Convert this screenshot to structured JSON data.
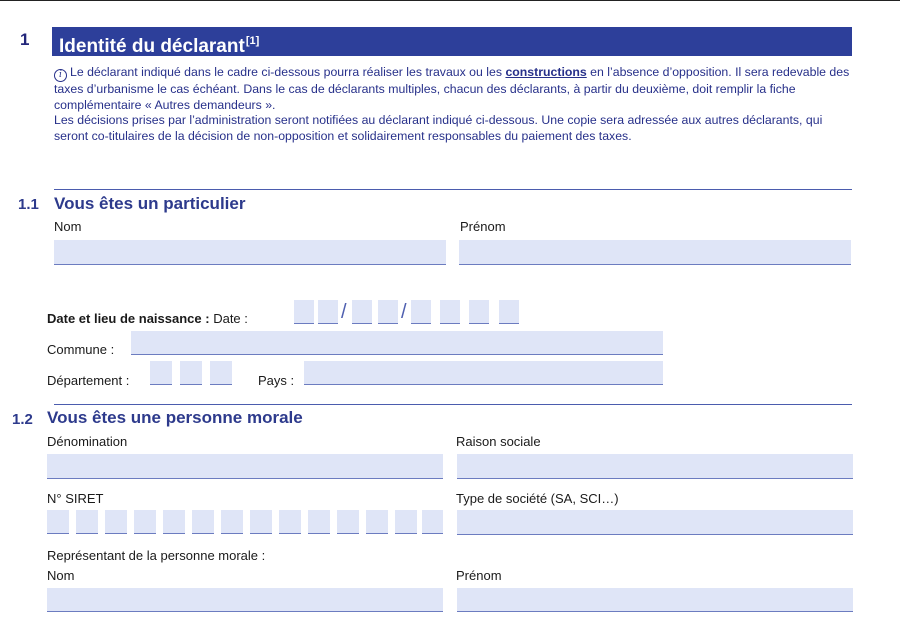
{
  "section": {
    "number": "1",
    "title": "Identité du déclarant",
    "footnote": "[1]"
  },
  "info": {
    "icon": "info-circle-icon",
    "text_before_link": "Le déclarant indiqué dans le cadre ci-dessous pourra réaliser les travaux ou les",
    "link": "constructions",
    "text_after_link": "en l’absence d’opposition. Il sera redevable des taxes d’urbanisme le cas échéant. Dans le cas de déclarants multiples, chacun des déclarants, à partir du deuxième, doit remplir la fiche complémentaire « Autres demandeurs ».",
    "paragraph2": "Les décisions prises par l’administration seront notifiées au déclarant indiqué ci-dessous. Une copie sera adressée aux autres déclarants, qui seront co-titulaires de la décision de non-opposition et solidairement responsables du paiement des taxes."
  },
  "particulier": {
    "number": "1.1",
    "title": "Vous êtes un particulier",
    "nom_label": "Nom",
    "prenom_label": "Prénom",
    "birth_label": "Date et lieu de naissance :",
    "date_label": "Date :",
    "commune_label": "Commune :",
    "departement_label": "Département :",
    "pays_label": "Pays :"
  },
  "morale": {
    "number": "1.2",
    "title": "Vous êtes une personne morale",
    "denomination_label": "Dénomination",
    "raison_label": "Raison sociale",
    "siret_label": "N° SIRET",
    "type_label": "Type de société (SA, SCI…)",
    "representant_label": "Représentant de la personne morale :",
    "nom_label": "Nom",
    "prenom_label": "Prénom"
  },
  "colors": {
    "header_bar": "#2d3f9a",
    "field_fill": "#dfe5f7",
    "text_blue": "#27308a"
  }
}
